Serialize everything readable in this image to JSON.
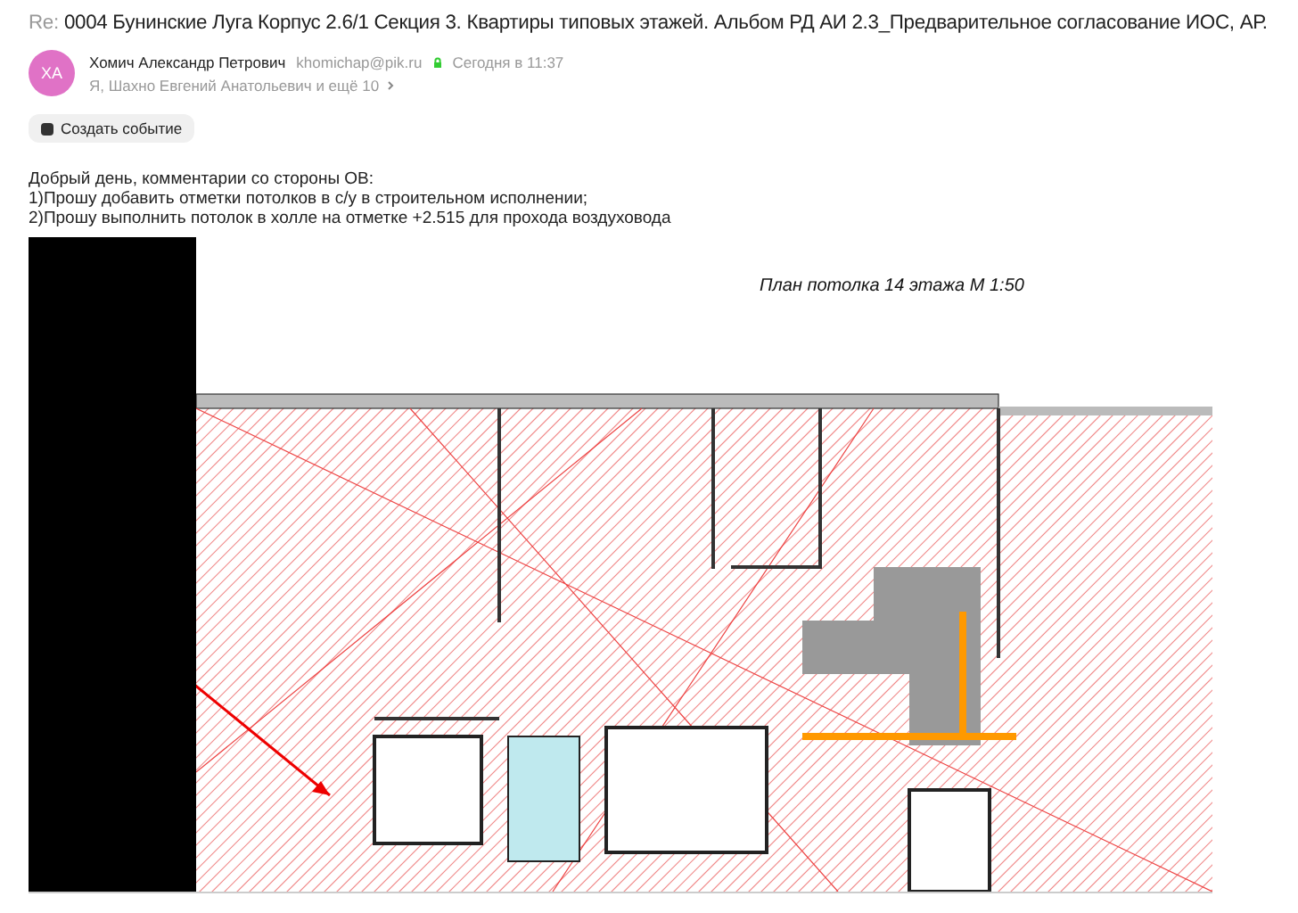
{
  "message": {
    "subject_prefix": "Re:",
    "subject": "0004 Бунинские Луга Корпус 2.6/1 Секция 3. Квартиры типовых этажей. Альбом РД АИ 2.3_Предварительное согласование ИОС, АР.",
    "sender": {
      "initials": "ХА",
      "name": "Хомич Александр Петрович",
      "email": "khomichap@pik.ru",
      "verified": true,
      "time": "Сегодня в 11:37"
    },
    "recipients": "Я, Шахно Евгений Анатольевич и ещё 10",
    "actions": [
      "Создать событие"
    ],
    "body": [
      "Добрый день, комментарии со стороны ОВ:",
      "1)Прошу добавить отметки потолков в с/у в строительном исполнении;",
      "2)Прошу выполнить потолок в холле на отметке +2.515 для прохода воздуховода"
    ],
    "attachment": {
      "title": "План потолка 14 этажа М 1:50"
    }
  }
}
